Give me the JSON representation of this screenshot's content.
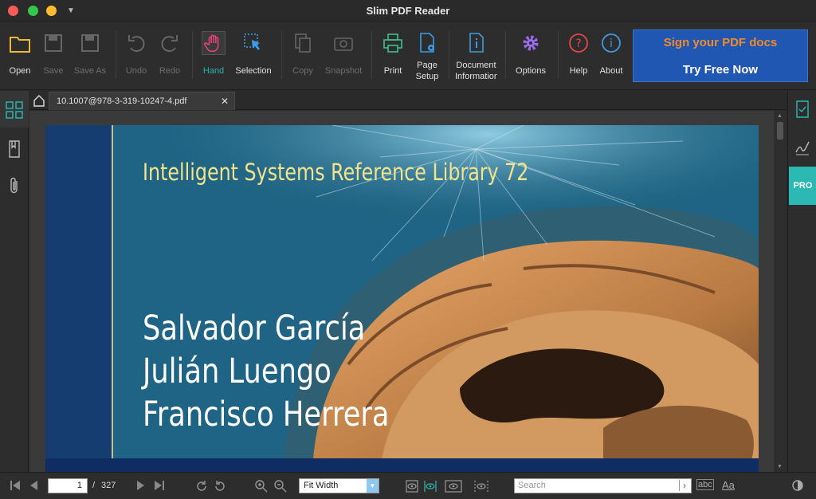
{
  "window": {
    "title": "Slim PDF Reader"
  },
  "toolbar": {
    "open": "Open",
    "save": "Save",
    "save_as": "Save As",
    "undo": "Undo",
    "redo": "Redo",
    "hand": "Hand",
    "selection": "Selection",
    "copy": "Copy",
    "snapshot": "Snapshot",
    "print": "Print",
    "page_setup_1": "Page",
    "page_setup_2": "Setup",
    "doc_info_1": "Document",
    "doc_info_2": "Information",
    "options": "Options",
    "help": "Help",
    "about": "About"
  },
  "promo": {
    "line1": "Sign your PDF docs",
    "line2": "Try Free Now"
  },
  "tabs": {
    "active_doc": "10.1007@978-3-319-10247-4.pdf",
    "close": "✕"
  },
  "rightbar": {
    "pro": "PRO"
  },
  "document": {
    "series": "Intelligent Systems Reference Library   72",
    "authors": [
      "Salvador García",
      "Julián Luengo",
      "Francisco Herrera"
    ]
  },
  "status": {
    "current_page": "1",
    "page_sep": "/",
    "total_pages": "327",
    "zoom": "Fit Width",
    "search_placeholder": "Search",
    "abc": "abc",
    "aa": "Aa"
  },
  "colors": {
    "accent": "#2cb8b3",
    "promo_bg": "#1f57b3",
    "promo_text": "#f28a2c",
    "series_text": "#f3e38b"
  }
}
